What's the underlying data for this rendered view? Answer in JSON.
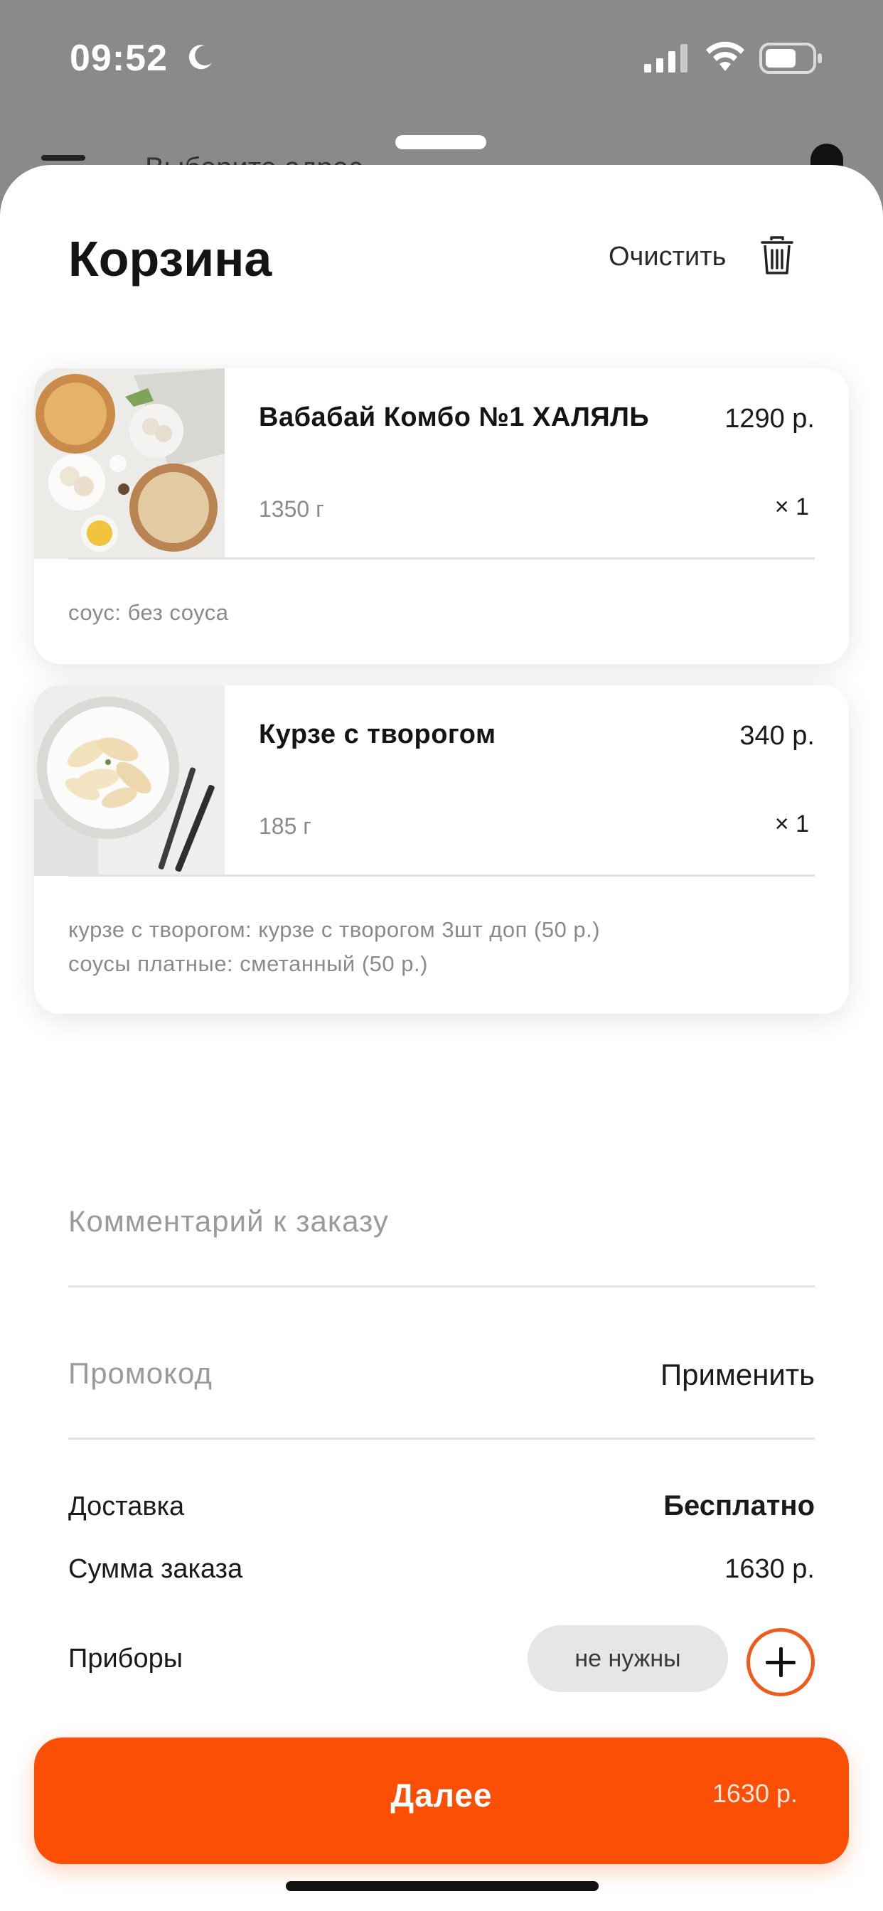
{
  "status_bar": {
    "time": "09:52"
  },
  "background_page": {
    "address_hint": "Выберите адрес"
  },
  "cart": {
    "title": "Корзина",
    "clear_label": "Очистить",
    "items": [
      {
        "name": "Вабабай Комбо №1  ХАЛЯЛЬ",
        "price": "1290 р.",
        "weight": "1350 г",
        "qty": "× 1",
        "modifiers": [
          "соус: без соуса"
        ]
      },
      {
        "name": "Курзе с творогом",
        "price": "340 р.",
        "weight": "185 г",
        "qty": "× 1",
        "modifiers": [
          "курзе с творогом: курзе с творогом 3шт доп (50 р.)",
          "соусы  платные: сметанный (50 р.)"
        ]
      }
    ]
  },
  "form": {
    "comment_placeholder": "Комментарий к заказу",
    "promo_placeholder": "Промокод",
    "apply_label": "Применить"
  },
  "summary": {
    "delivery_label": "Доставка",
    "delivery_value": "Бесплатно",
    "sum_label": "Сумма заказа",
    "sum_value": "1630 р.",
    "cutlery_label": "Приборы",
    "cutlery_value": "не нужны"
  },
  "footer": {
    "next_label": "Далее",
    "next_price": "1630 р."
  },
  "colors": {
    "accent": "#fb4f06",
    "muted": "#8a8a8a"
  }
}
